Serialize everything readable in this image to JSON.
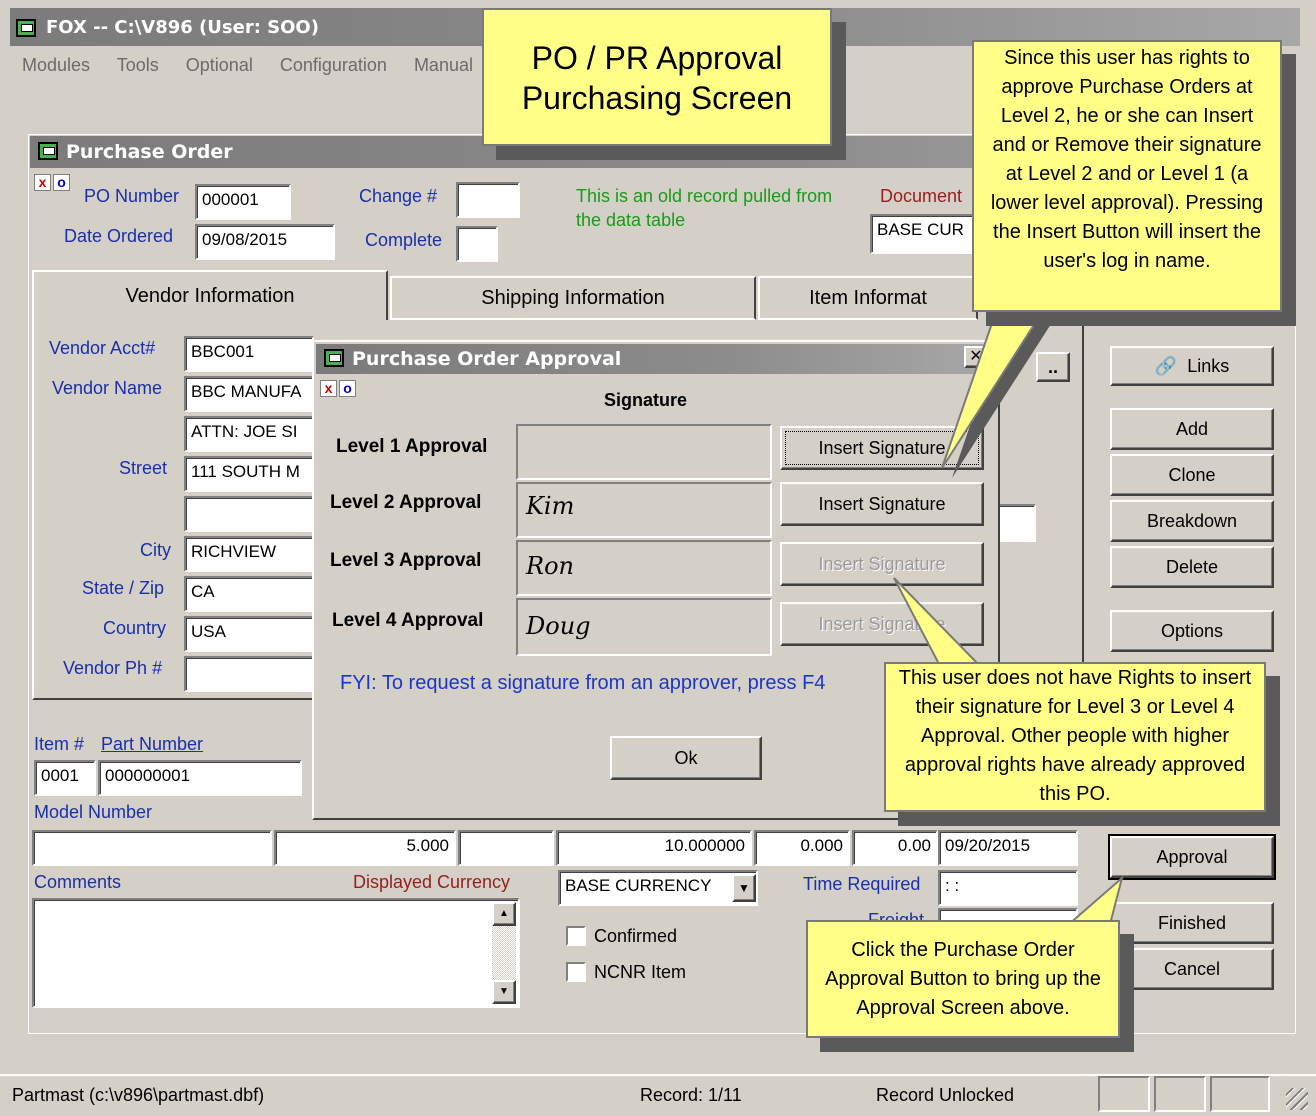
{
  "app": {
    "title": "FOX -- C:\\V896  (User: SOO)",
    "menu": [
      "Modules",
      "Tools",
      "Optional",
      "Configuration",
      "Manual"
    ]
  },
  "callouts": {
    "header": "PO / PR Approval\nPurchasing Screen",
    "rights": "Since this user has rights to approve Purchase Orders at Level 2, he or she can Insert and or Remove their signature at Level 2 and or Level 1 (a lower level approval). Pressing the Insert Button will insert the user's log in name.",
    "no_rights": "This user does not have Rights to insert their signature for Level 3 or Level 4 Approval.  Other people with higher approval rights have already approved this PO.",
    "approval_button": "Click the Purchase Order Approval Button to bring up the Approval Screen above."
  },
  "po": {
    "window_title": "Purchase Order",
    "po_number_label": "PO Number",
    "po_number": "000001",
    "date_ordered_label": "Date Ordered",
    "date_ordered": "09/08/2015",
    "change_label": "Change #",
    "change_value": "",
    "complete_label": "Complete",
    "old_record_msg": "This is an old record pulled from the data table",
    "document_label": "Document",
    "document_currency": "BASE CUR",
    "tabs": [
      "Vendor Information",
      "Shipping Information",
      "Item Informat"
    ],
    "vendor": {
      "acct_label": "Vendor Acct#",
      "acct": "BBC001",
      "name_label": "Vendor Name",
      "name": "BBC MANUFA",
      "attn": "ATTN: JOE SI",
      "street_label": "Street",
      "street": "111 SOUTH M",
      "street2": "",
      "city_label": "City",
      "city": "RICHVIEW",
      "state_label": "State / Zip",
      "state": "CA",
      "country_label": "Country",
      "country": "USA",
      "phone_label": "Vendor Ph #",
      "phone": ""
    },
    "item": {
      "item_num_label": "Item #",
      "part_number_label": "Part Number",
      "item_num": "0001",
      "part_number": "000000001",
      "model_label": "Model Number",
      "model": "",
      "qty": "5.000",
      "blank1": "",
      "price": "10.000000",
      "disc": "0.000",
      "total": "0.00",
      "due_date": "09/20/2015",
      "comments_label": "Comments",
      "comments": "",
      "displayed_currency_label": "Displayed Currency",
      "displayed_currency": "BASE CURRENCY",
      "time_required_label": "Time Required",
      "time_required": " :  :",
      "freight_label": "Freight",
      "confirmed_label": "Confirmed",
      "ncnr_label": "NCNR Item"
    },
    "side_buttons": {
      "links": "Links",
      "add": "Add",
      "clone": "Clone",
      "breakdown": "Breakdown",
      "delete": "Delete",
      "options": "Options",
      "approval": "Approval",
      "finished": "Finished",
      "cancel": "Cancel"
    }
  },
  "approval_dialog": {
    "title": "Purchase Order Approval",
    "heading": "Signature",
    "levels": [
      {
        "label": "Level 1 Approval",
        "signature": "",
        "button": "Insert Signature"
      },
      {
        "label": "Level  2 Approval",
        "signature": "Kim",
        "button": "Insert Signature"
      },
      {
        "label": "Level  3 Approval",
        "signature": "Ron",
        "button": "Insert Signature"
      },
      {
        "label": "Level  4 Approval",
        "signature": "Doug",
        "button": "Insert Signature"
      }
    ],
    "fyi": "FYI:  To request a signature from an approver, press F4",
    "ok": "Ok"
  },
  "status_bar": {
    "file": "Partmast (c:\\v896\\partmast.dbf)",
    "record": "Record: 1/11",
    "lock": "Record Unlocked"
  },
  "colors": {
    "window_bg": "#d4d0c8",
    "titlebar": "#7b7b7b",
    "note": "#ffff88",
    "label_blue": "#1a2fa8",
    "msg_green": "#1a9a1a",
    "label_maroon": "#9a1c1c"
  }
}
